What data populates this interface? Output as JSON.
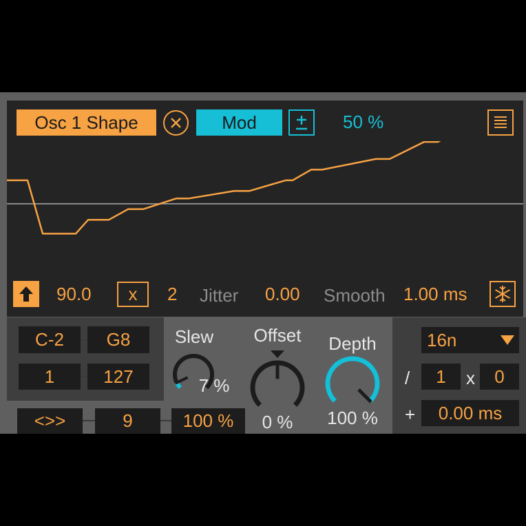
{
  "header": {
    "target_label": "Osc 1 Shape",
    "mode_label": "Mod",
    "amount": "50 %"
  },
  "waveform": {
    "points": [
      0.22,
      0.22,
      -0.28,
      -0.28,
      -0.15,
      -0.15,
      -0.05,
      -0.05,
      0.05,
      0.05,
      0.12,
      0.12,
      0.22,
      0.22,
      0.32,
      0.32,
      0.42,
      0.42,
      0.58,
      0.58,
      0.76,
      0.76,
      0.62,
      0.62
    ]
  },
  "controls": {
    "rate": "90.0",
    "multiply_symbol": "x",
    "multiplier": "2",
    "jitter_label": "Jitter",
    "jitter": "0.00",
    "smooth_label": "Smooth",
    "smooth": "1.00 ms"
  },
  "range": {
    "note_low": "C-2",
    "note_high": "G8",
    "vel_low": "1",
    "vel_high": "127"
  },
  "bottom_row": {
    "direction": "<>>",
    "steps": "9",
    "percent": "100 %"
  },
  "knobs": {
    "slew": {
      "label": "Slew",
      "value": "7 %",
      "level": 0.07
    },
    "offset": {
      "label": "Offset",
      "value": "0 %",
      "level": 0.5
    },
    "depth": {
      "label": "Depth",
      "value": "100 %",
      "level": 1.0
    }
  },
  "sync": {
    "division": "16n",
    "divide_symbol": "/",
    "div_value": "1",
    "mult_symbol": "x",
    "mult_value": "0",
    "plus_symbol": "+",
    "offset_ms": "0.00 ms"
  },
  "colors": {
    "accent": "#f7a243",
    "mod": "#16bfd6",
    "background": "#242424"
  }
}
